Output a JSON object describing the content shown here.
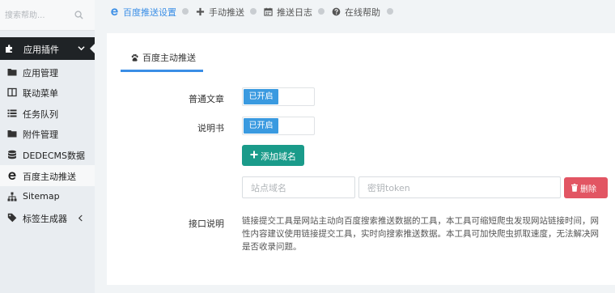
{
  "sidebar": {
    "search_placeholder": "搜索帮助...",
    "group": {
      "label": "应用插件",
      "icon": "puzzle-icon",
      "expanded": true
    },
    "items": [
      {
        "label": "应用管理",
        "icon": "folder-icon"
      },
      {
        "label": "联动菜单",
        "icon": "columns-icon"
      },
      {
        "label": "任务队列",
        "icon": "list-icon"
      },
      {
        "label": "附件管理",
        "icon": "folder-icon"
      },
      {
        "label": "DEDECMS数据",
        "icon": "database-icon"
      },
      {
        "label": "百度主动推送",
        "icon": "ie-icon",
        "active": true
      },
      {
        "label": "Sitemap",
        "icon": "sitemap-icon"
      },
      {
        "label": "标签生成器",
        "icon": "tag-icon"
      }
    ]
  },
  "tabs": [
    {
      "label": "百度推送设置",
      "icon": "ie-icon",
      "active": true
    },
    {
      "label": "手动推送",
      "icon": "plus-icon"
    },
    {
      "label": "推送日志",
      "icon": "calendar-icon"
    },
    {
      "label": "在线帮助",
      "icon": "question-circle-icon"
    }
  ],
  "panel": {
    "tab_label": "百度主动推送",
    "tab_icon": "paw-icon",
    "rows": {
      "article": {
        "label": "普通文章",
        "toggle": "已开启"
      },
      "manual": {
        "label": "说明书",
        "toggle": "已开启"
      }
    },
    "add_domain_label": "添加域名",
    "domain_placeholder": "站点域名",
    "token_placeholder": "密钥token",
    "delete_label": "删除",
    "desc_label": "接口说明",
    "desc_lines": [
      "链接提交工具是网站主动向百度搜索推送数据的工具，本工具可缩短爬虫发现网站链接时间，网",
      "性内容建议使用链接提交工具，实时向搜索推送数据。本工具可加快爬虫抓取速度，无法解决网",
      "是否收录问题。"
    ]
  },
  "colors": {
    "accent": "#3a8ee6",
    "toggle_on": "#3a9ae0",
    "add_button": "#1a9b8a",
    "delete_button": "#e25563",
    "menu_dark": "#1f2326"
  }
}
